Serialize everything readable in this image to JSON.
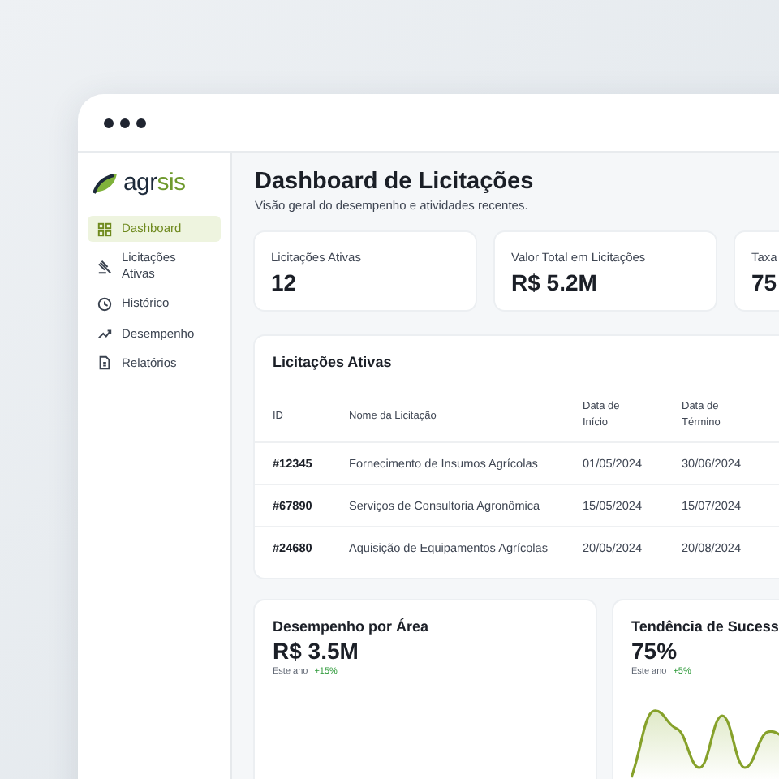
{
  "logo": {
    "main": "agr",
    "accent": "sis"
  },
  "sidebar": {
    "items": [
      {
        "label": "Dashboard",
        "selected": true
      },
      {
        "label": "Licitações Ativas",
        "selected": false
      },
      {
        "label": "Histórico",
        "selected": false
      },
      {
        "label": "Desempenho",
        "selected": false
      },
      {
        "label": "Relatórios",
        "selected": false
      }
    ]
  },
  "header": {
    "title": "Dashboard de Licitações",
    "subtitle": "Visão geral do desempenho e atividades recentes."
  },
  "stats": [
    {
      "label": "Licitações Ativas",
      "value": "12"
    },
    {
      "label": "Valor Total em Licitações",
      "value": "R$ 5.2M"
    },
    {
      "label": "Taxa",
      "value": "75"
    }
  ],
  "table": {
    "title": "Licitações Ativas",
    "columns": [
      "ID",
      "Nome da Licitação",
      "Data de Início",
      "Data de Término"
    ],
    "rows": [
      [
        "#12345",
        "Fornecimento de Insumos Agrícolas",
        "01/05/2024",
        "30/06/2024"
      ],
      [
        "#67890",
        "Serviços de Consultoria Agronômica",
        "15/05/2024",
        "15/07/2024"
      ],
      [
        "#24680",
        "Aquisição de Equipamentos Agrícolas",
        "20/05/2024",
        "20/08/2024"
      ]
    ]
  },
  "panels": [
    {
      "title": "Desempenho por Área",
      "value": "R$ 3.5M",
      "period": "Este ano",
      "change": "+15%",
      "kind": "plain"
    },
    {
      "title": "Tendência de Sucess",
      "value": "75%",
      "period": "Este ano",
      "change": "+5%",
      "kind": "sparkline"
    }
  ]
}
